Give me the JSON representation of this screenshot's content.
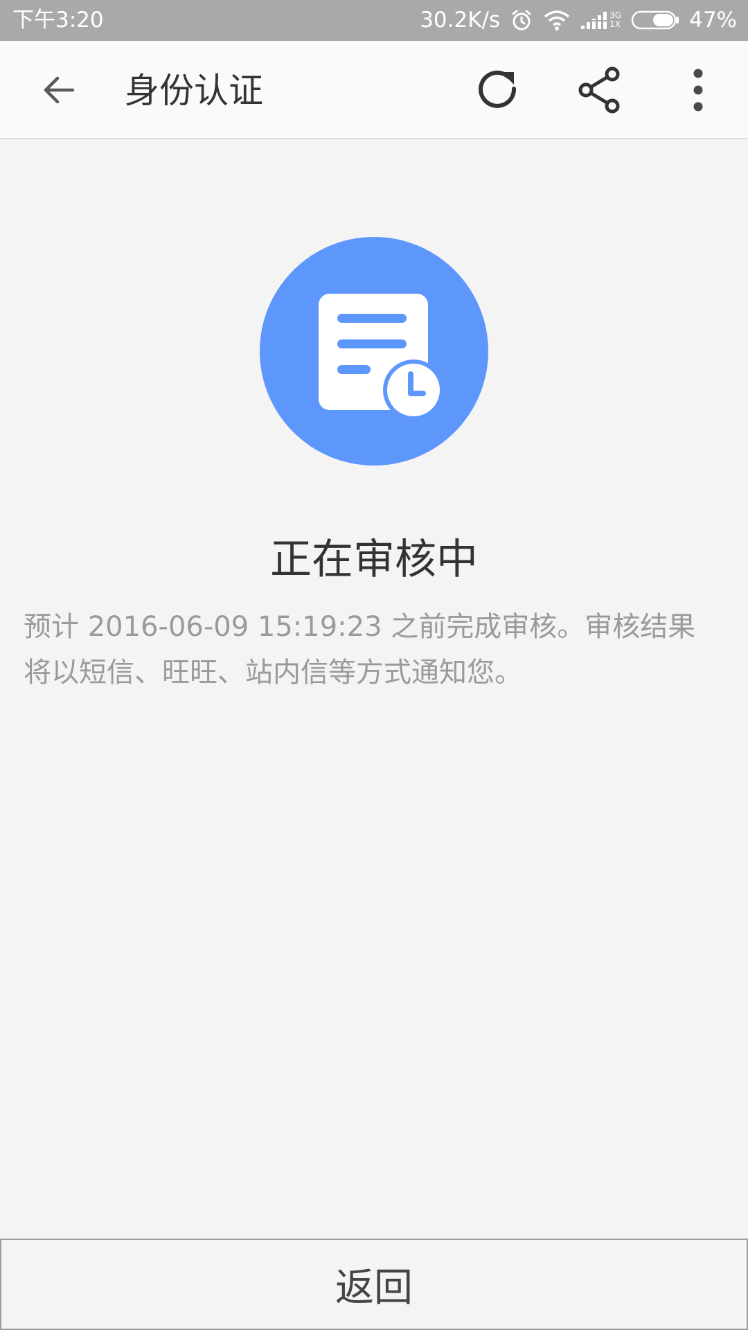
{
  "status_bar": {
    "time": "下午3:20",
    "network_speed": "30.2K/s",
    "signal_labels": [
      "3G",
      "1X"
    ],
    "battery": "47%",
    "icons": [
      "alarm-icon",
      "wifi-icon",
      "signal-icon",
      "battery-icon"
    ]
  },
  "toolbar": {
    "title": "身份认证",
    "icons": [
      "back-arrow-icon",
      "refresh-icon",
      "share-icon",
      "more-vert-icon"
    ]
  },
  "content": {
    "status_icon": "document-clock-icon",
    "title": "正在审核中",
    "description": "预计 2016-06-09 15:19:23 之前完成审核。审核结果将以短信、旺旺、站内信等方式通知您。"
  },
  "footer": {
    "return_label": "返回"
  },
  "colors": {
    "status_bar_bg": "#a9a9a9",
    "toolbar_bg": "#fafafa",
    "page_bg": "#f4f4f4",
    "accent_blue": "#5e97fc",
    "title_text": "#333333",
    "desc_text": "#9a9a9a"
  }
}
